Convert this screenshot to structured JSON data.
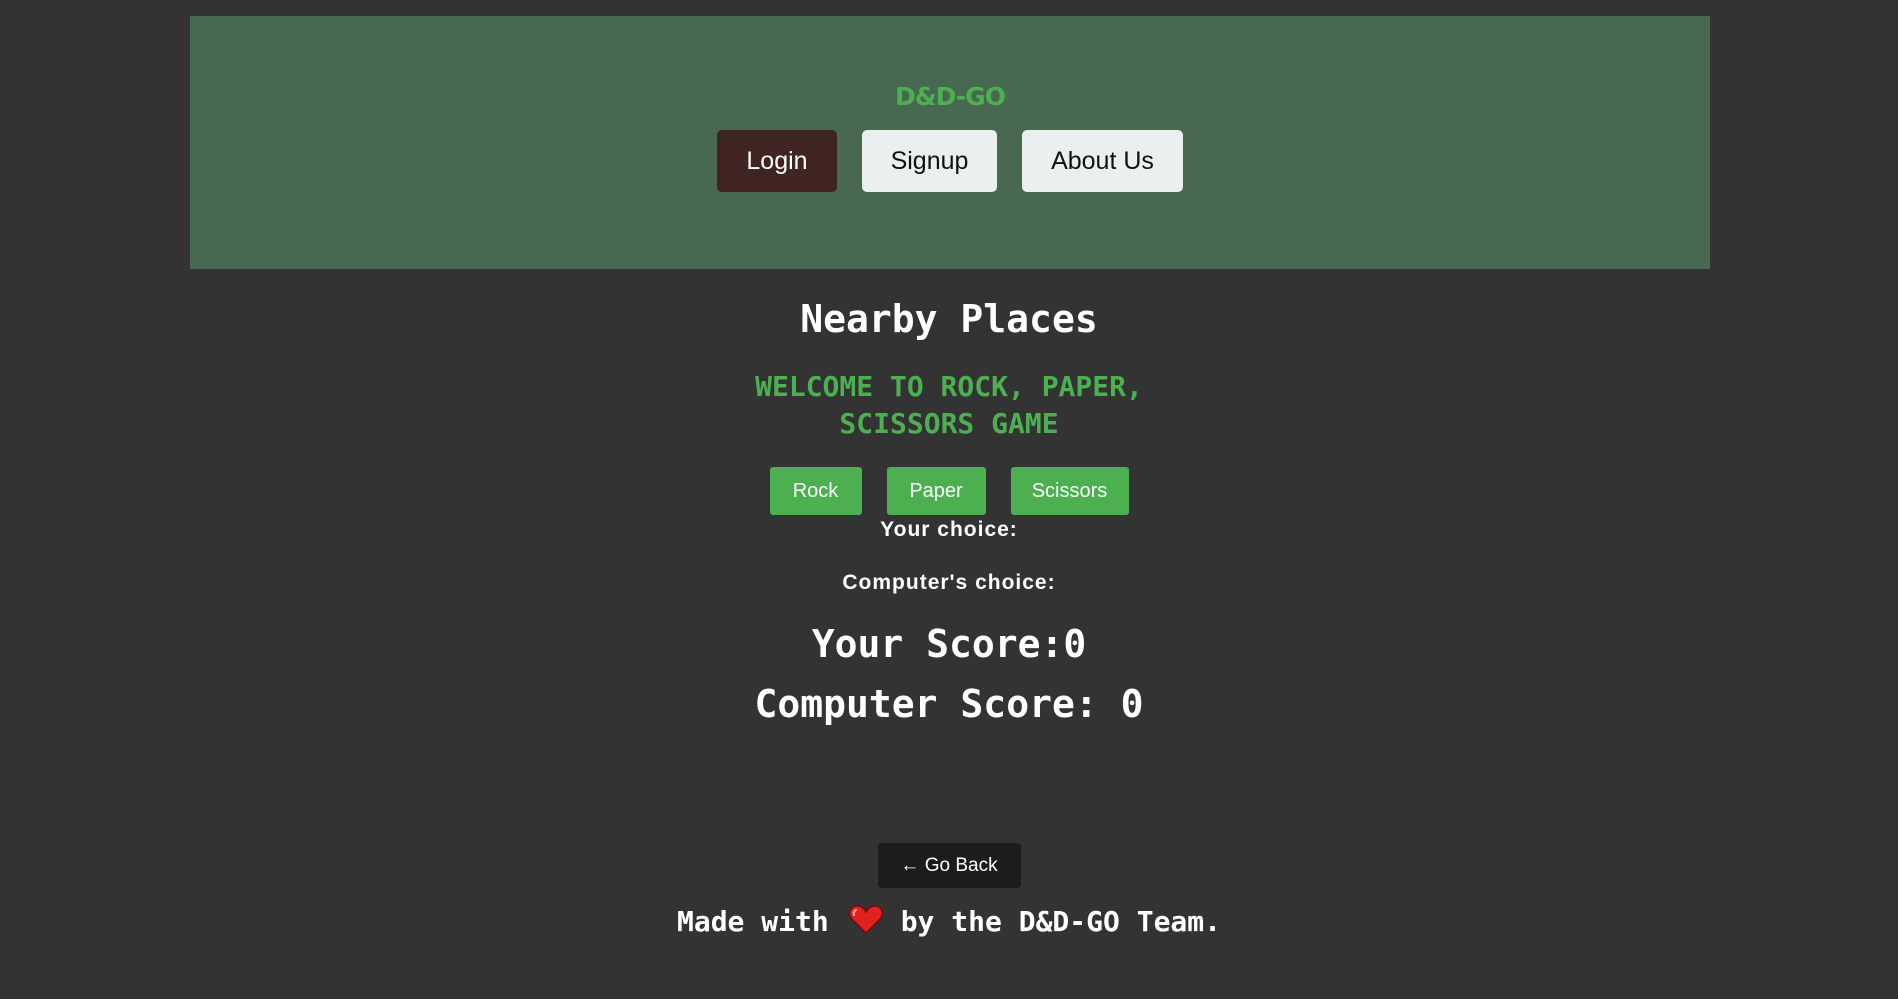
{
  "header": {
    "brand": "D&D-GO",
    "nav": {
      "login": "Login",
      "signup": "Signup",
      "about": "About Us"
    }
  },
  "main": {
    "page_title": "Nearby Places",
    "welcome_line1": "WELCOME TO ROCK, PAPER,",
    "welcome_line2": "SCISSORS GAME",
    "choices": {
      "rock": "Rock",
      "paper": "Paper",
      "scissors": "Scissors"
    },
    "your_choice_label": "Your choice:",
    "computer_choice_label": "Computer's choice:",
    "your_score": "Your Score:0",
    "computer_score": "Computer Score: 0"
  },
  "back_button": "← Go Back",
  "footer": {
    "made_with": "Made with",
    "by_team": "by the D&D-GO Team.",
    "heart_icon": "heart-icon"
  },
  "colors": {
    "background": "#333333",
    "header_bg": "#496852",
    "accent_green": "#4caf50",
    "login_bg": "#3f2422",
    "light_button_bg": "#eaeff0",
    "back_button_bg": "#1c1c1c",
    "heart": "#e0211f"
  }
}
